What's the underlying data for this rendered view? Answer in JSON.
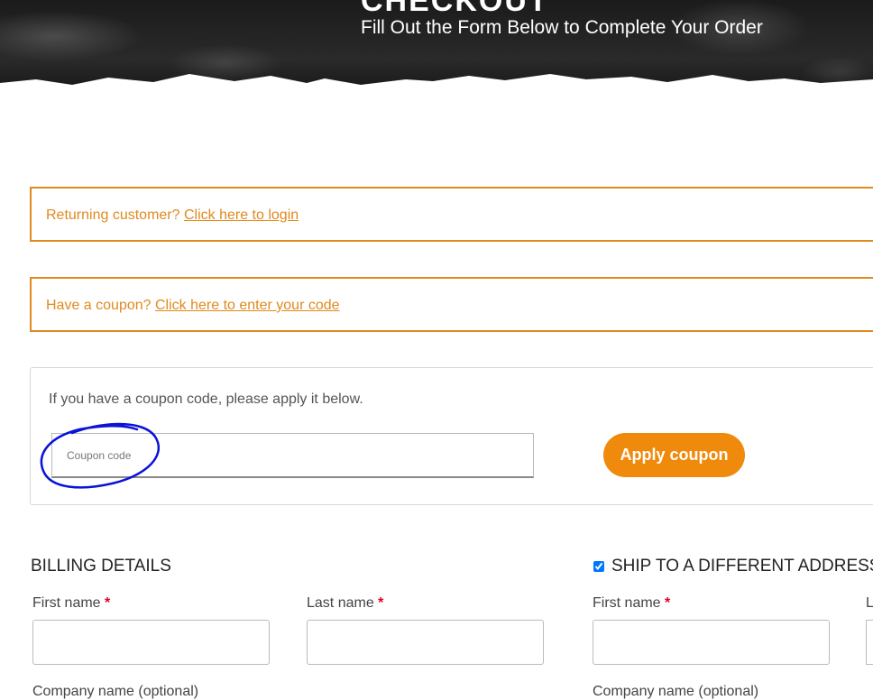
{
  "header": {
    "title": "CHECKOUT",
    "subtitle": "Fill Out the Form Below to Complete Your Order"
  },
  "notices": {
    "login": {
      "prefix": "Returning customer?",
      "link": "Click here to login"
    },
    "coupon": {
      "prefix": "Have a coupon?",
      "link": "Click here to enter your code"
    }
  },
  "coupon_form": {
    "hint": "If you have a coupon code, please apply it below.",
    "input_placeholder": "Coupon code",
    "input_value": "",
    "apply_label": "Apply coupon"
  },
  "billing": {
    "title": "BILLING DETAILS",
    "first_name_label": "First name",
    "last_name_label": "Last name",
    "company_label": "Company name (optional)",
    "required_mark": "*"
  },
  "shipping": {
    "title": "SHIP TO A DIFFERENT ADDRESS?",
    "checked": true,
    "first_name_label": "First name",
    "company_label": "Company name (optional)",
    "required_mark": "*",
    "cut_label": "L"
  },
  "colors": {
    "accent": "#f08a0c",
    "notice_text": "#e08a1e",
    "required": "#e0001b",
    "annotation": "#0a12d8"
  }
}
